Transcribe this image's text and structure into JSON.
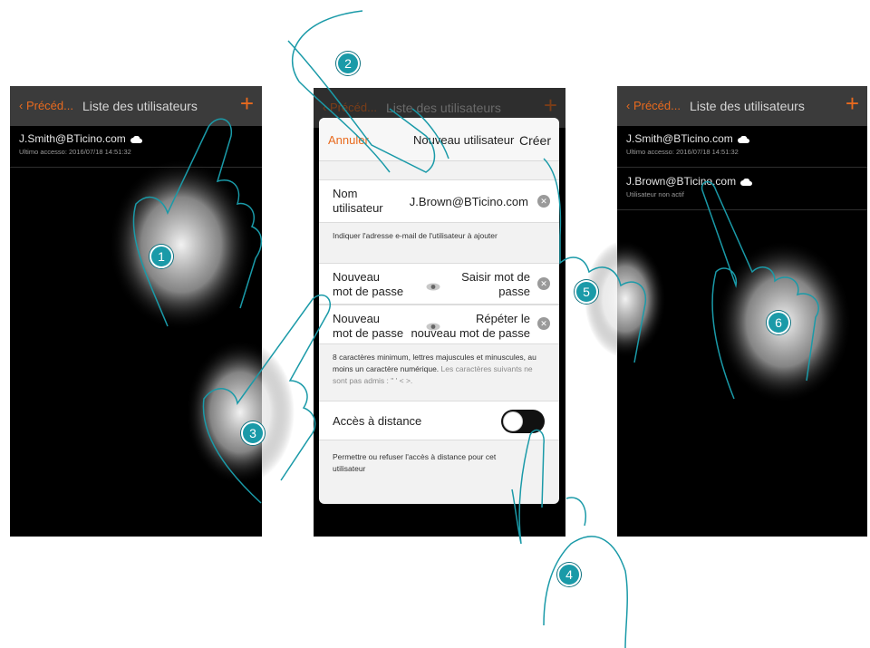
{
  "colors": {
    "accent": "#e86a1e",
    "step_badge": "#1a9aa8",
    "hand_outline": "#1a9aa8"
  },
  "left_screen": {
    "back_label": "Précéd...",
    "title": "Liste des utilisateurs",
    "add_icon": "+",
    "users": [
      {
        "email": "J.Smith@BTicino.com",
        "status": "Ultimo accesso: 2016/07/18  14:51:32"
      }
    ]
  },
  "middle_screen": {
    "back_label": "Précéd...",
    "title": "Liste des utilisateurs",
    "add_icon": "+",
    "modal": {
      "cancel_label": "Annuler",
      "title": "Nouveau utilisateur",
      "create_label": "Créer",
      "username_label_1": "Nom",
      "username_label_2": "utilisateur",
      "username_value": "J.Brown@BTicino.com",
      "username_hint": "Indiquer l'adresse e-mail de l'utilisateur à ajouter",
      "password_label_1": "Nouveau",
      "password_label_2": "mot de passe",
      "password_placeholder_1": "Saisir mot de",
      "password_placeholder_2": "passe",
      "confirm_label_1": "Nouveau",
      "confirm_label_2": "mot de passe",
      "confirm_placeholder_1": "Répéter le",
      "confirm_placeholder_2": "nouveau mot de passe",
      "password_hint": "8 caractères minimum, lettres majuscules et minuscules, au moins un caractère numérique.",
      "password_hint_grey": "Les caractères suivants ne sont pas admis : \" ' < >.",
      "remote_label": "Accès à distance",
      "remote_enabled": false,
      "remote_hint": "Permettre ou refuser l'accès à distance pour cet utilisateur"
    }
  },
  "right_screen": {
    "back_label": "Précéd...",
    "title": "Liste des utilisateurs",
    "add_icon": "+",
    "users": [
      {
        "email": "J.Smith@BTicino.com",
        "status": "Ultimo accesso: 2016/07/18  14:51:32"
      },
      {
        "email": "J.Brown@BTicino.com",
        "status": "Utilisateur non actif"
      }
    ]
  },
  "steps": [
    "1",
    "2",
    "3",
    "4",
    "5",
    "6"
  ]
}
